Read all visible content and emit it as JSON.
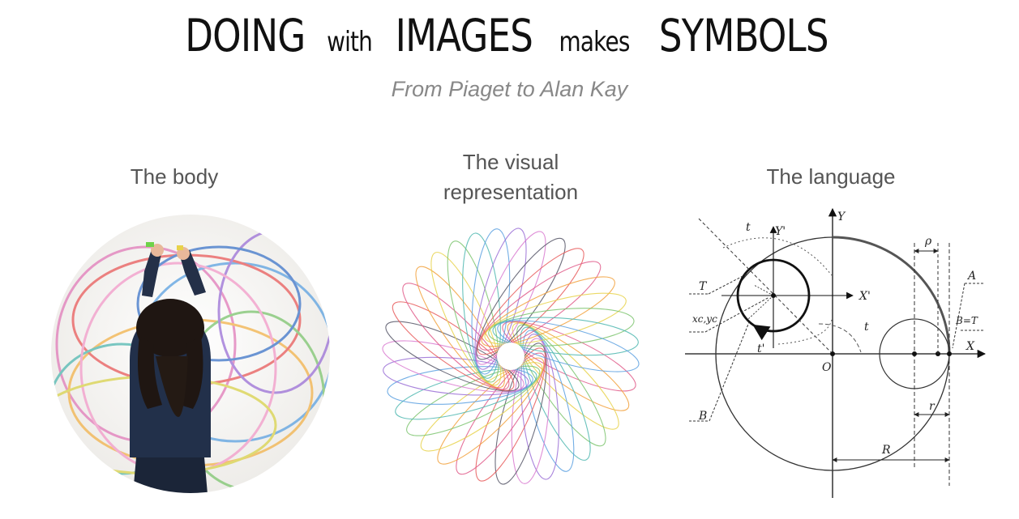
{
  "title": {
    "part1": "DOING",
    "part2": "with",
    "part3": "IMAGES",
    "part4": "makes",
    "part5": "SYMBOLS"
  },
  "subtitle": "From Piaget to Alan Kay",
  "columns": {
    "body": "The body",
    "visual_line1": "The visual",
    "visual_line2": "representation",
    "language": "The language"
  },
  "diagram_labels": {
    "y": "Y",
    "y_prime": "Y'",
    "x": "X",
    "x_prime": "X'",
    "t_top": "t",
    "t_mid": "t",
    "t_prime": "t'",
    "T": "T",
    "xc_yc": "xc,yc",
    "rho": "ρ",
    "A": "A",
    "B_eq_T": "B=T",
    "O": "O",
    "B": "B",
    "r": "r",
    "R": "R"
  }
}
